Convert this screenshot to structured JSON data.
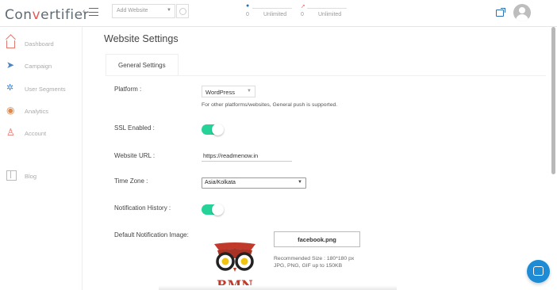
{
  "brand": {
    "logo_text_a": "Con",
    "logo_dot": "v",
    "logo_text_b": "ertifier"
  },
  "topbar": {
    "website_select_placeholder": "Add Website",
    "stats": [
      {
        "icon": "user-icon",
        "value": "0",
        "label": "Unlimited",
        "color": "#2d6fb5"
      },
      {
        "icon": "rocket-icon",
        "value": "0",
        "label": "Unlimited",
        "color": "#e06a60"
      }
    ]
  },
  "sidebar": {
    "items": [
      {
        "label": "Dashboard",
        "icon": "home-icon"
      },
      {
        "label": "Campaign",
        "icon": "send-icon"
      },
      {
        "label": "User Segments",
        "icon": "segments-icon"
      },
      {
        "label": "Analytics",
        "icon": "eye-icon"
      },
      {
        "label": "Account",
        "icon": "user-icon"
      },
      {
        "label": "Blog",
        "icon": "blog-icon"
      }
    ]
  },
  "main": {
    "title": "Website Settings",
    "tab": "General Settings",
    "platform": {
      "label": "Platform :",
      "value": "WordPress",
      "help": "For other platforms/websites, General push is supported."
    },
    "ssl": {
      "label": "SSL Enabled :",
      "enabled": true
    },
    "url": {
      "label": "Website URL :",
      "value": "https://readmenow.in"
    },
    "timezone": {
      "label": "Time Zone :",
      "value": "Asia/Kolkata"
    },
    "history": {
      "label": "Notification History :",
      "enabled": true
    },
    "image": {
      "label": "Default Notification Image:",
      "file_button": "facebook.png",
      "logo_text": "RMN",
      "recommended_line1": "Recommended Size : 180*180 px",
      "recommended_line2": "JPG, PNG, GIF up to 150KB"
    }
  },
  "colors": {
    "toggle_on": "#25d398",
    "accent": "#1d8bd6"
  }
}
